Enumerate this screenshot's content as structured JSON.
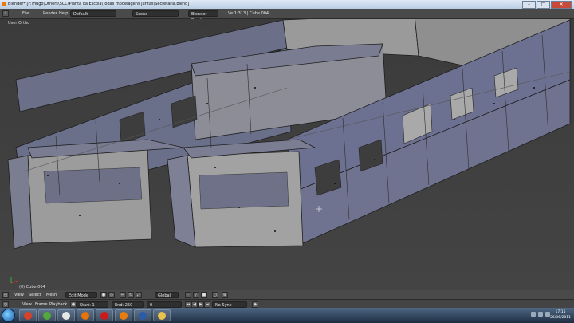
{
  "window": {
    "title": "Blender* [F:\\Hugo\\Others\\SCC\\Planta da Escola\\Todas modelagens juntas\\Secretaria.blend]"
  },
  "menubar": {
    "menus": [
      "File",
      "Render",
      "Help"
    ],
    "layout": "Default",
    "scene": "Scene",
    "engine": "Blender Render",
    "stats": "Ve:1:313 | Cube.004"
  },
  "viewport": {
    "view_label": "User Ortho",
    "object_label": "(0) Cube.004"
  },
  "header3d": {
    "menus": [
      "View",
      "Select",
      "Mesh"
    ],
    "mode": "Edit Mode",
    "orientation": "Global"
  },
  "timeline": {
    "menus": [
      "View",
      "Frame",
      "Playback"
    ],
    "start": "Start: 1",
    "end": "End: 250",
    "current": "0",
    "sync": "No Sync"
  },
  "taskbar": {
    "apps": [
      {
        "icon": "chrome-icon",
        "color": "#d9412a"
      },
      {
        "icon": "utorrent-icon",
        "color": "#53a83b"
      },
      {
        "icon": "media-player-icon",
        "color": "#e6e6e6"
      },
      {
        "icon": "firefox-icon",
        "color": "#e8720c"
      },
      {
        "icon": "opera-icon",
        "color": "#cc1a1a"
      },
      {
        "icon": "blender-icon",
        "color": "#e87d0d"
      },
      {
        "icon": "word-icon",
        "color": "#2a5caa"
      },
      {
        "icon": "explorer-icon",
        "color": "#e7c24d"
      }
    ],
    "time": "17:15",
    "date": "26/06/2011"
  }
}
